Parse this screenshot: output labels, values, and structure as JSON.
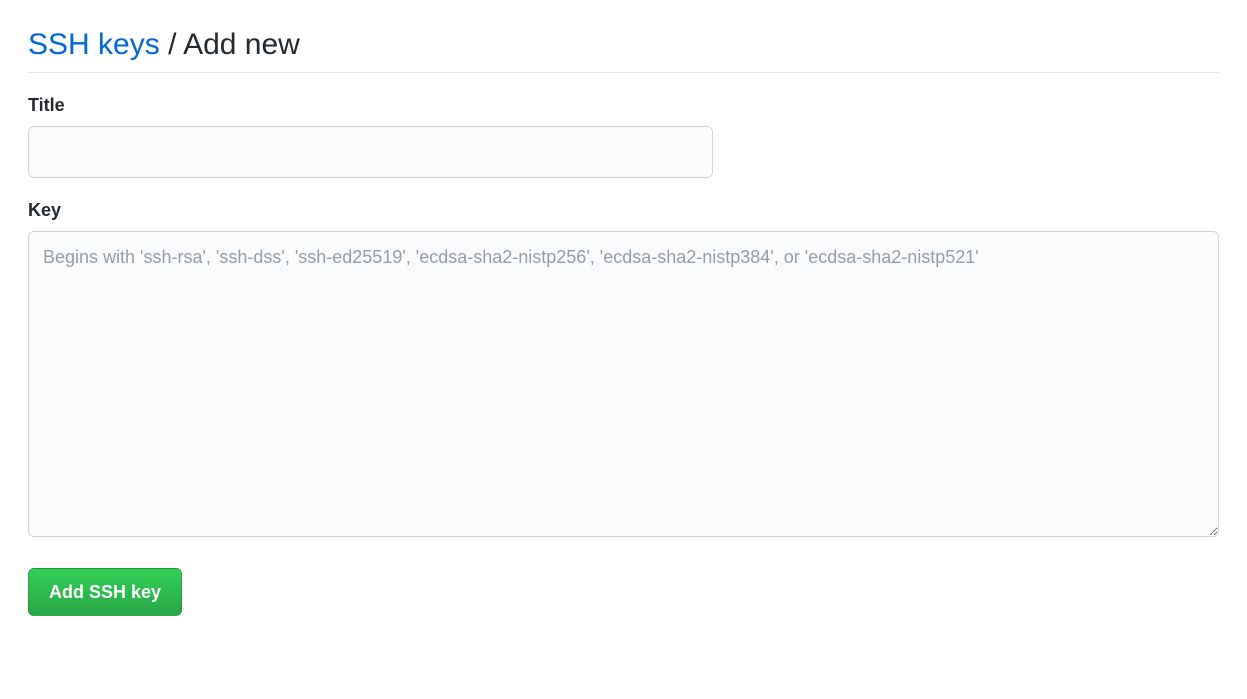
{
  "heading": {
    "link_text": "SSH keys",
    "separator": "/",
    "subpage": "Add new"
  },
  "form": {
    "title_label": "Title",
    "title_value": "",
    "key_label": "Key",
    "key_value": "",
    "key_placeholder": "Begins with 'ssh-rsa', 'ssh-dss', 'ssh-ed25519', 'ecdsa-sha2-nistp256', 'ecdsa-sha2-nistp384', or 'ecdsa-sha2-nistp521'",
    "submit_label": "Add SSH key"
  }
}
